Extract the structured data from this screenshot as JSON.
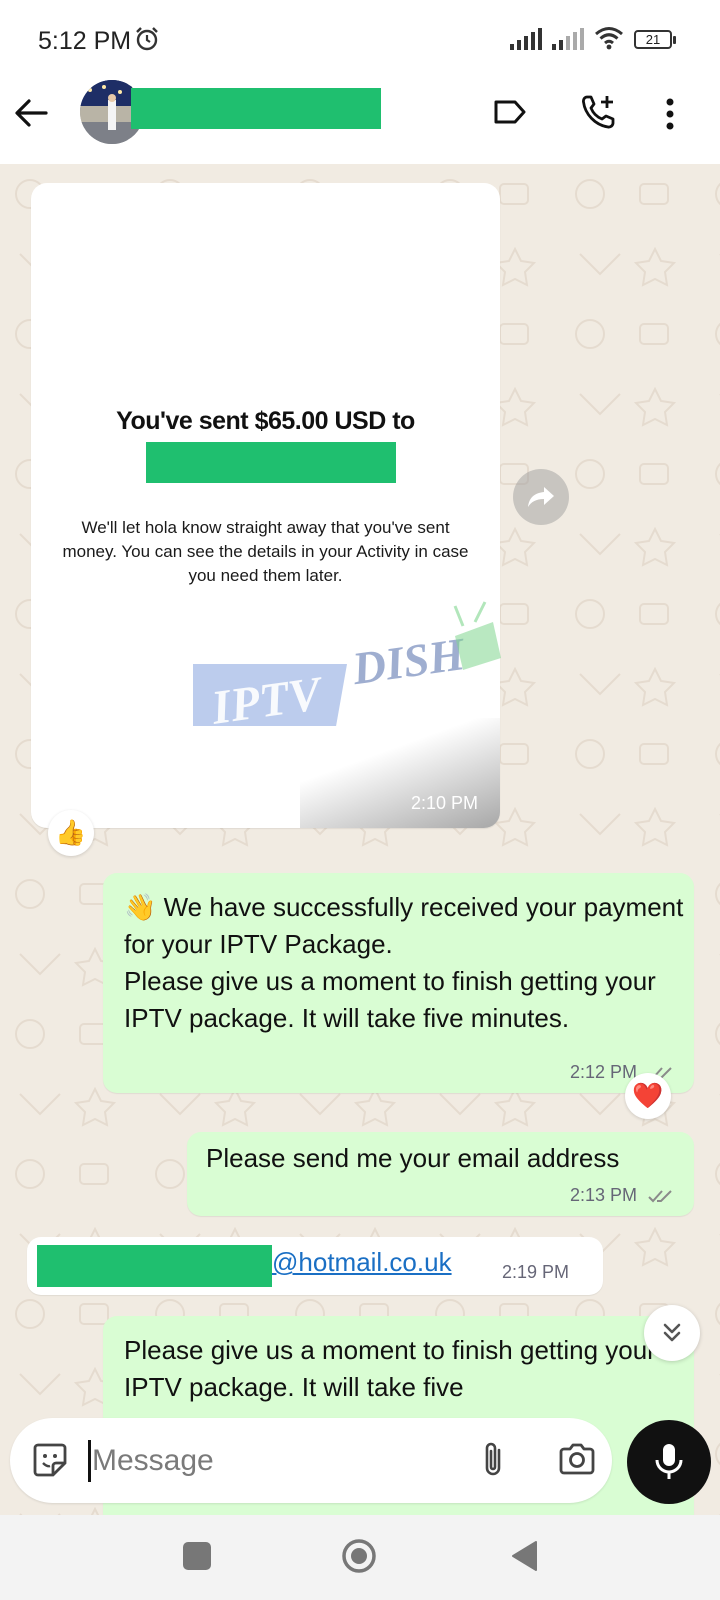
{
  "status_bar": {
    "time": "5:12 PM",
    "battery": "21"
  },
  "header": {
    "back_icon": "arrow-left-icon",
    "label_icon": "label-tag-icon",
    "call_icon": "add-call-icon",
    "more_icon": "more-vertical-icon"
  },
  "messages": {
    "image_message": {
      "title": "You've sent $65.00 USD to",
      "description": "We'll let hola know straight away that you've sent money. You can see the details in your Activity in case you need them later.",
      "watermark_left": "IPTV",
      "watermark_right": "DISH",
      "time": "2:10 PM",
      "reaction": "👍"
    },
    "msg1": {
      "emoji": "👋",
      "text": " We have successfully received your payment for your IPTV Package.\nPlease give us a moment to finish getting your IPTV package. It will take five minutes.",
      "time": "2:12 PM",
      "reaction": "❤️"
    },
    "msg2": {
      "text": "Please send me your email address",
      "time": "2:13 PM"
    },
    "msg3": {
      "email": "@hotmail.co.uk",
      "time": "2:19 PM"
    },
    "msg4": {
      "text": "Please give us a moment to finish getting your IPTV package. It will take five"
    }
  },
  "input": {
    "placeholder": "Message"
  },
  "colors": {
    "redaction": "#1fbf6f",
    "outgoing_bubble": "#d9fdd3",
    "chat_background": "#f1ebe2",
    "link": "#1a6fc4"
  }
}
